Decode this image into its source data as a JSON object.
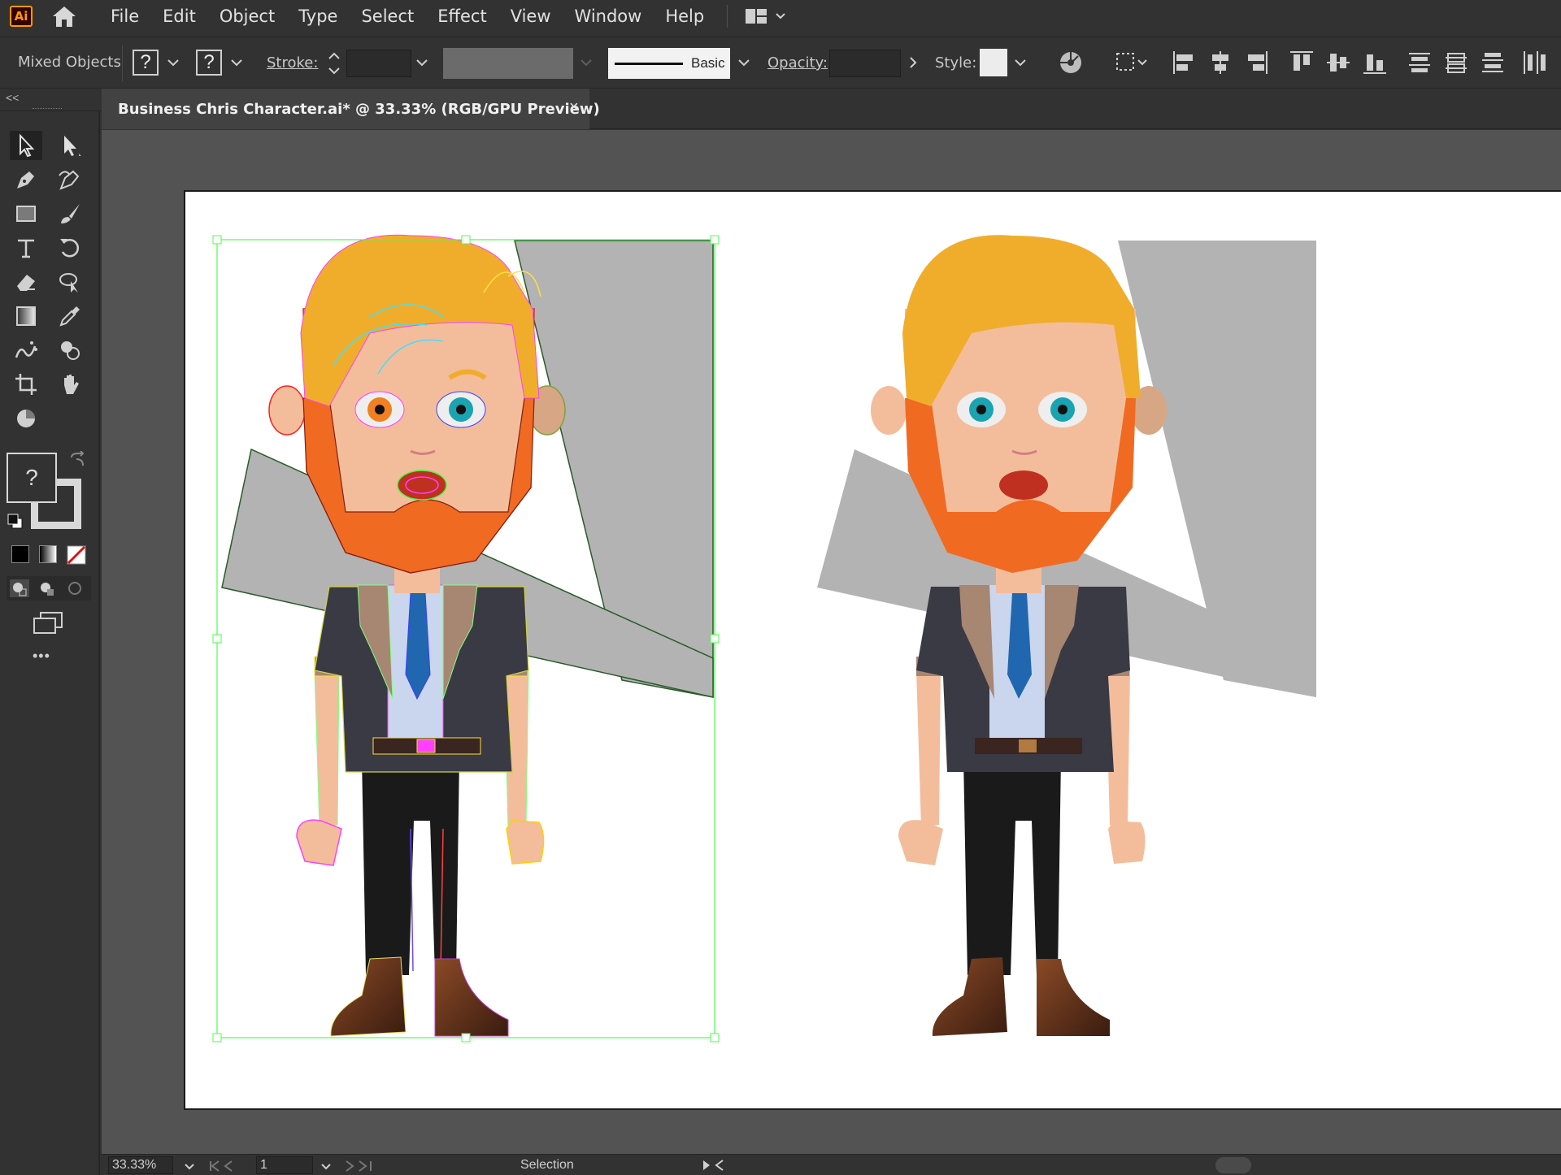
{
  "app": {
    "logo_text": "Ai"
  },
  "menu": {
    "items": [
      "File",
      "Edit",
      "Object",
      "Type",
      "Select",
      "Effect",
      "View",
      "Window",
      "Help"
    ]
  },
  "control_bar": {
    "selection_type": "Mixed Objects",
    "fill_value": "?",
    "stroke_swatch_value": "?",
    "stroke_label": "Stroke:",
    "brush_profile": "Basic",
    "opacity_label": "Opacity:",
    "style_label": "Style:"
  },
  "document_tab": {
    "title": "Business Chris Character.ai* @ 33.33% (RGB/GPU Preview)",
    "close_glyph": "×"
  },
  "toolbar": {
    "collapse_glyph": "<<",
    "fill_stroke_unknown": "?",
    "fill_small_unknown": "?",
    "stroke_small_unknown": "?",
    "edit_toolbar_glyph": "•••"
  },
  "status_bar": {
    "zoom": "33.33%",
    "artboard_number": "1",
    "tool_name": "Selection"
  },
  "colors": {
    "ui_bg": "#323232",
    "canvas_bg": "#535353",
    "artboard_bg": "#ffffff",
    "selection_green": "#4cff4c",
    "hair": "#f0ad2b",
    "beard": "#f06a22",
    "skin": "#f3bd9c",
    "jacket": "#3a3a44",
    "tie": "#2067b0",
    "gray_shape": "#b3b3b3"
  }
}
